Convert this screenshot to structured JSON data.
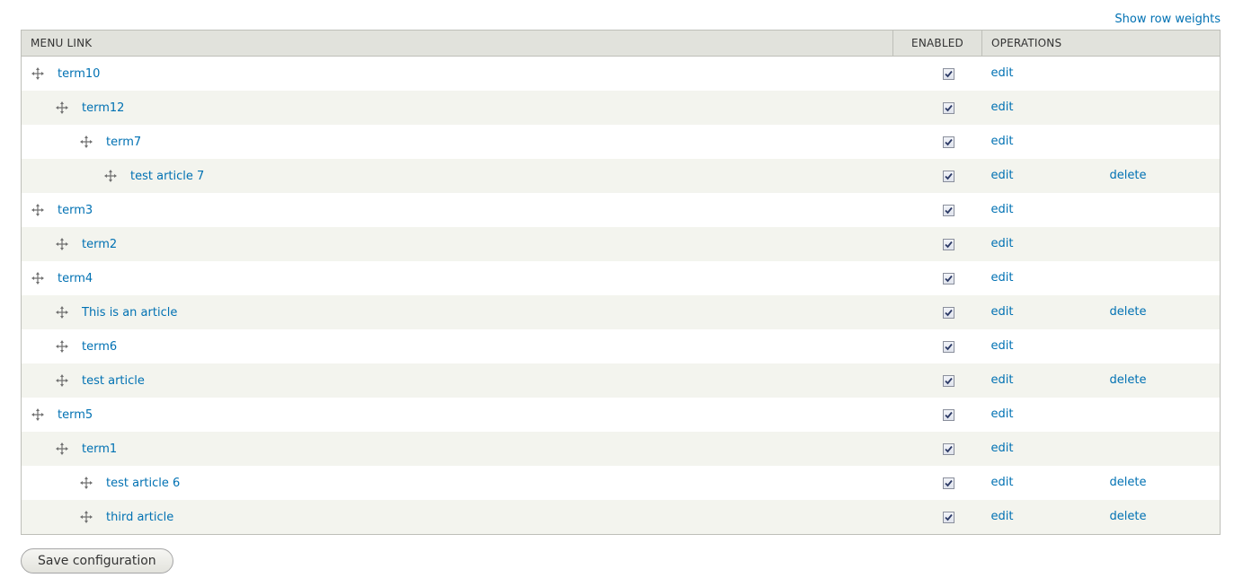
{
  "toggle_weights_label": "Show row weights",
  "table": {
    "headers": {
      "menu_link": "MENU LINK",
      "enabled": "ENABLED",
      "operations": "OPERATIONS"
    },
    "rows": [
      {
        "title": "term10",
        "depth": 0,
        "enabled": true,
        "edit": "edit",
        "delete": ""
      },
      {
        "title": "term12",
        "depth": 1,
        "enabled": true,
        "edit": "edit",
        "delete": ""
      },
      {
        "title": "term7",
        "depth": 2,
        "enabled": true,
        "edit": "edit",
        "delete": ""
      },
      {
        "title": "test article 7",
        "depth": 3,
        "enabled": true,
        "edit": "edit",
        "delete": "delete"
      },
      {
        "title": "term3",
        "depth": 0,
        "enabled": true,
        "edit": "edit",
        "delete": ""
      },
      {
        "title": "term2",
        "depth": 1,
        "enabled": true,
        "edit": "edit",
        "delete": ""
      },
      {
        "title": "term4",
        "depth": 0,
        "enabled": true,
        "edit": "edit",
        "delete": ""
      },
      {
        "title": "This is an article",
        "depth": 1,
        "enabled": true,
        "edit": "edit",
        "delete": "delete"
      },
      {
        "title": "term6",
        "depth": 1,
        "enabled": true,
        "edit": "edit",
        "delete": ""
      },
      {
        "title": "test article",
        "depth": 1,
        "enabled": true,
        "edit": "edit",
        "delete": "delete"
      },
      {
        "title": "term5",
        "depth": 0,
        "enabled": true,
        "edit": "edit",
        "delete": ""
      },
      {
        "title": "term1",
        "depth": 1,
        "enabled": true,
        "edit": "edit",
        "delete": ""
      },
      {
        "title": "test article 6",
        "depth": 2,
        "enabled": true,
        "edit": "edit",
        "delete": "delete"
      },
      {
        "title": "third article",
        "depth": 2,
        "enabled": true,
        "edit": "edit",
        "delete": "delete"
      }
    ]
  },
  "save_button_label": "Save configuration",
  "colors": {
    "link": "#0071b3",
    "header_bg": "#e1e2dc",
    "row_alt_bg": "#f3f4ee",
    "border": "#bebfb9"
  },
  "icons": {
    "drag_handle": "drag-handle-icon",
    "checkbox_check": "checkmark-icon"
  }
}
